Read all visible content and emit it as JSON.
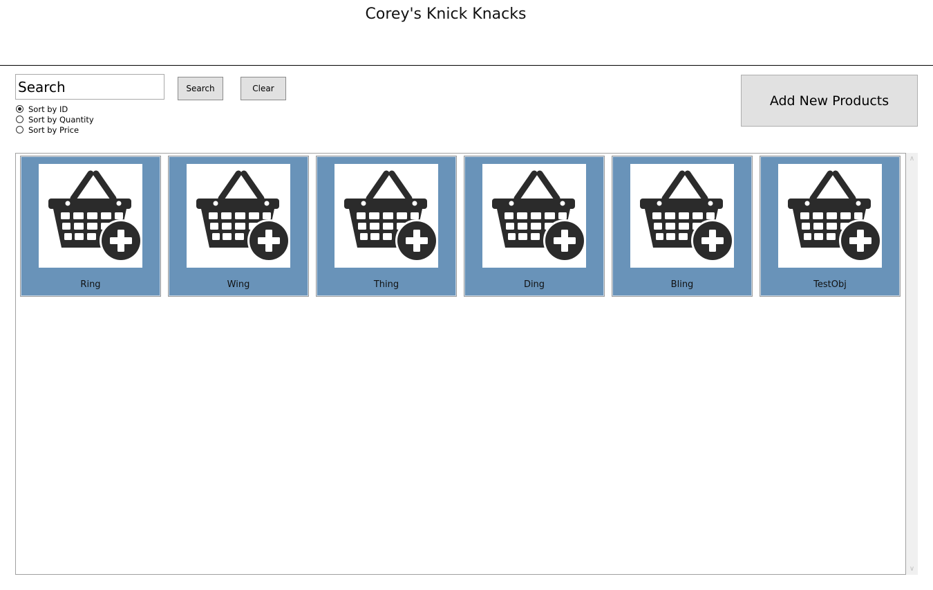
{
  "app": {
    "title": "Corey's Knick Knacks"
  },
  "search": {
    "value": "Search",
    "button_label": "Search",
    "clear_label": "Clear"
  },
  "sort": {
    "options": [
      {
        "label": "Sort by ID",
        "selected": true
      },
      {
        "label": "Sort by Quantity",
        "selected": false
      },
      {
        "label": "Sort by Price",
        "selected": false
      }
    ]
  },
  "actions": {
    "add_products_label": "Add New Products"
  },
  "products": [
    {
      "name": "Ring",
      "icon": "basket-add-icon"
    },
    {
      "name": "Wing",
      "icon": "basket-add-icon"
    },
    {
      "name": "Thing",
      "icon": "basket-add-icon"
    },
    {
      "name": "Ding",
      "icon": "basket-add-icon"
    },
    {
      "name": "Bling",
      "icon": "basket-add-icon"
    },
    {
      "name": "TestObj",
      "icon": "basket-add-icon"
    }
  ],
  "colors": {
    "tile_background": "#6993b9",
    "button_background": "#e1e1e1",
    "icon_color": "#2b2b2b"
  }
}
